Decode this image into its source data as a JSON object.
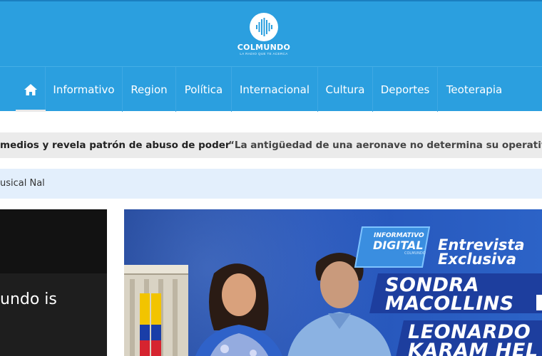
{
  "brand": {
    "name": "COLMUNDO",
    "tagline": "LA RADIO QUE TE ACERCA",
    "accent": "#2b9fdf"
  },
  "nav": {
    "home_icon": "home-icon",
    "items": [
      {
        "label": "Informativo"
      },
      {
        "label": "Region"
      },
      {
        "label": "Política"
      },
      {
        "label": "Internacional"
      },
      {
        "label": "Cultura"
      },
      {
        "label": "Deportes"
      },
      {
        "label": "Teoterapia"
      }
    ]
  },
  "ticker": {
    "items": [
      "medios y revela patrón de abuso de poder",
      "“La antigüedad de una aeronave no determina su operatividad”: I"
    ]
  },
  "subbar": {
    "text": "usical Nal"
  },
  "left_panel": {
    "text": "undo is"
  },
  "hero": {
    "badge_line1": "INFORMATIVO",
    "badge_line2": "DIGITAL",
    "badge_line3": "COLMUNDO",
    "headline_line1": "Entrevista",
    "headline_line2": "Exclusiva",
    "guest1_first": "SONDRA",
    "guest1_last": "MACOLLINS",
    "guest2_first": "LEONARDO",
    "guest2_last": "KARAM HEL"
  }
}
